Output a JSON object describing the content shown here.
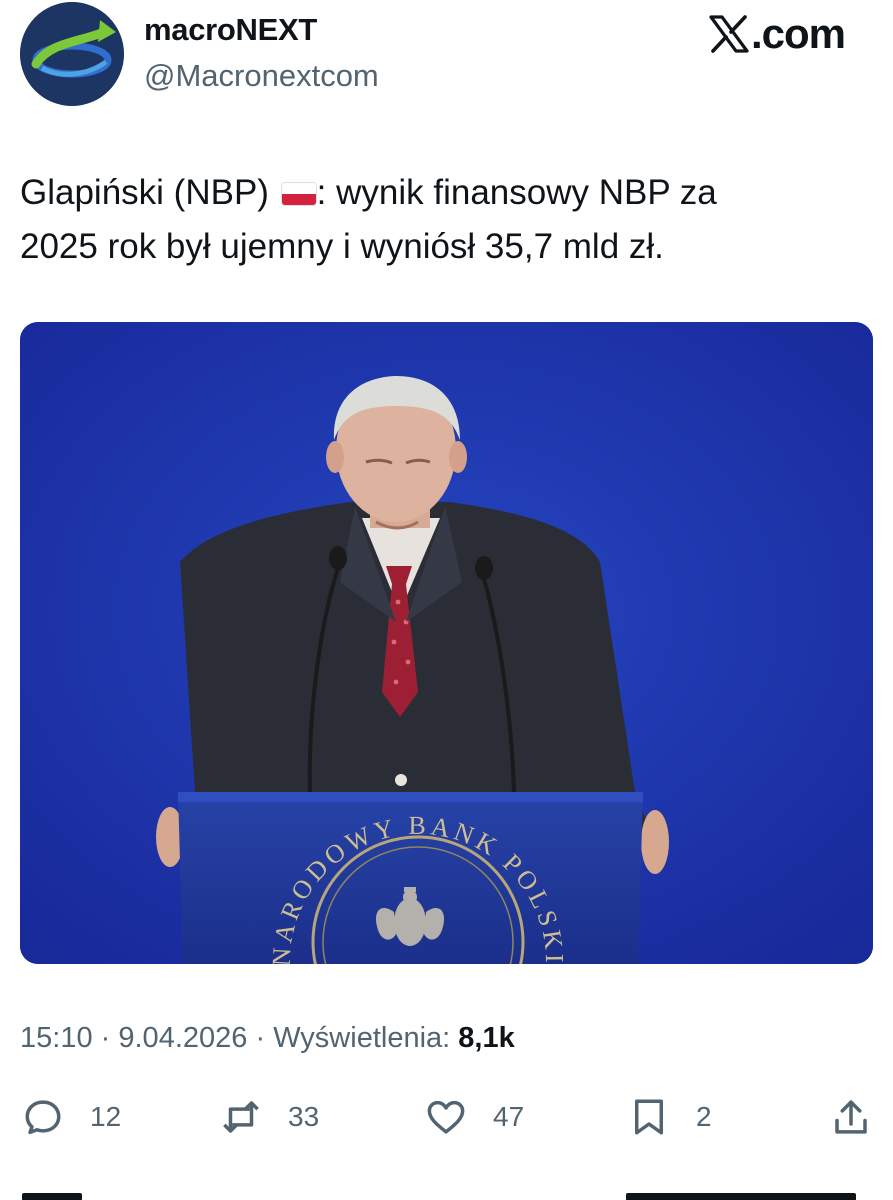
{
  "author": {
    "display_name": "macroNEXT",
    "handle": "@Macronextcom",
    "avatar_icon": "macronext-logo-icon"
  },
  "brand": {
    "label": ".com",
    "icon": "x-logo-icon"
  },
  "tweet": {
    "text_line_1_start": "Glapiński (NBP) ",
    "text_line_1_flag": "poland-flag-icon",
    "text_line_1_end": ":  wynik finansowy NBP za",
    "text_line_2": "2025 rok był ujemny i wyniósł 35,7 mld zł."
  },
  "media": {
    "podium_text": "NARODOWY BANK POLSKI"
  },
  "meta": {
    "time": "15:10",
    "separator": "·",
    "date": "9.04.2026",
    "views_label": "Wyświetlenia:",
    "views_count": "8,1k"
  },
  "actions": {
    "replies": "12",
    "reposts": "33",
    "likes": "47",
    "bookmarks": "2"
  },
  "colors": {
    "text_primary": "#0f1419",
    "text_secondary": "#536471",
    "background_blue": "#1f37a8"
  }
}
